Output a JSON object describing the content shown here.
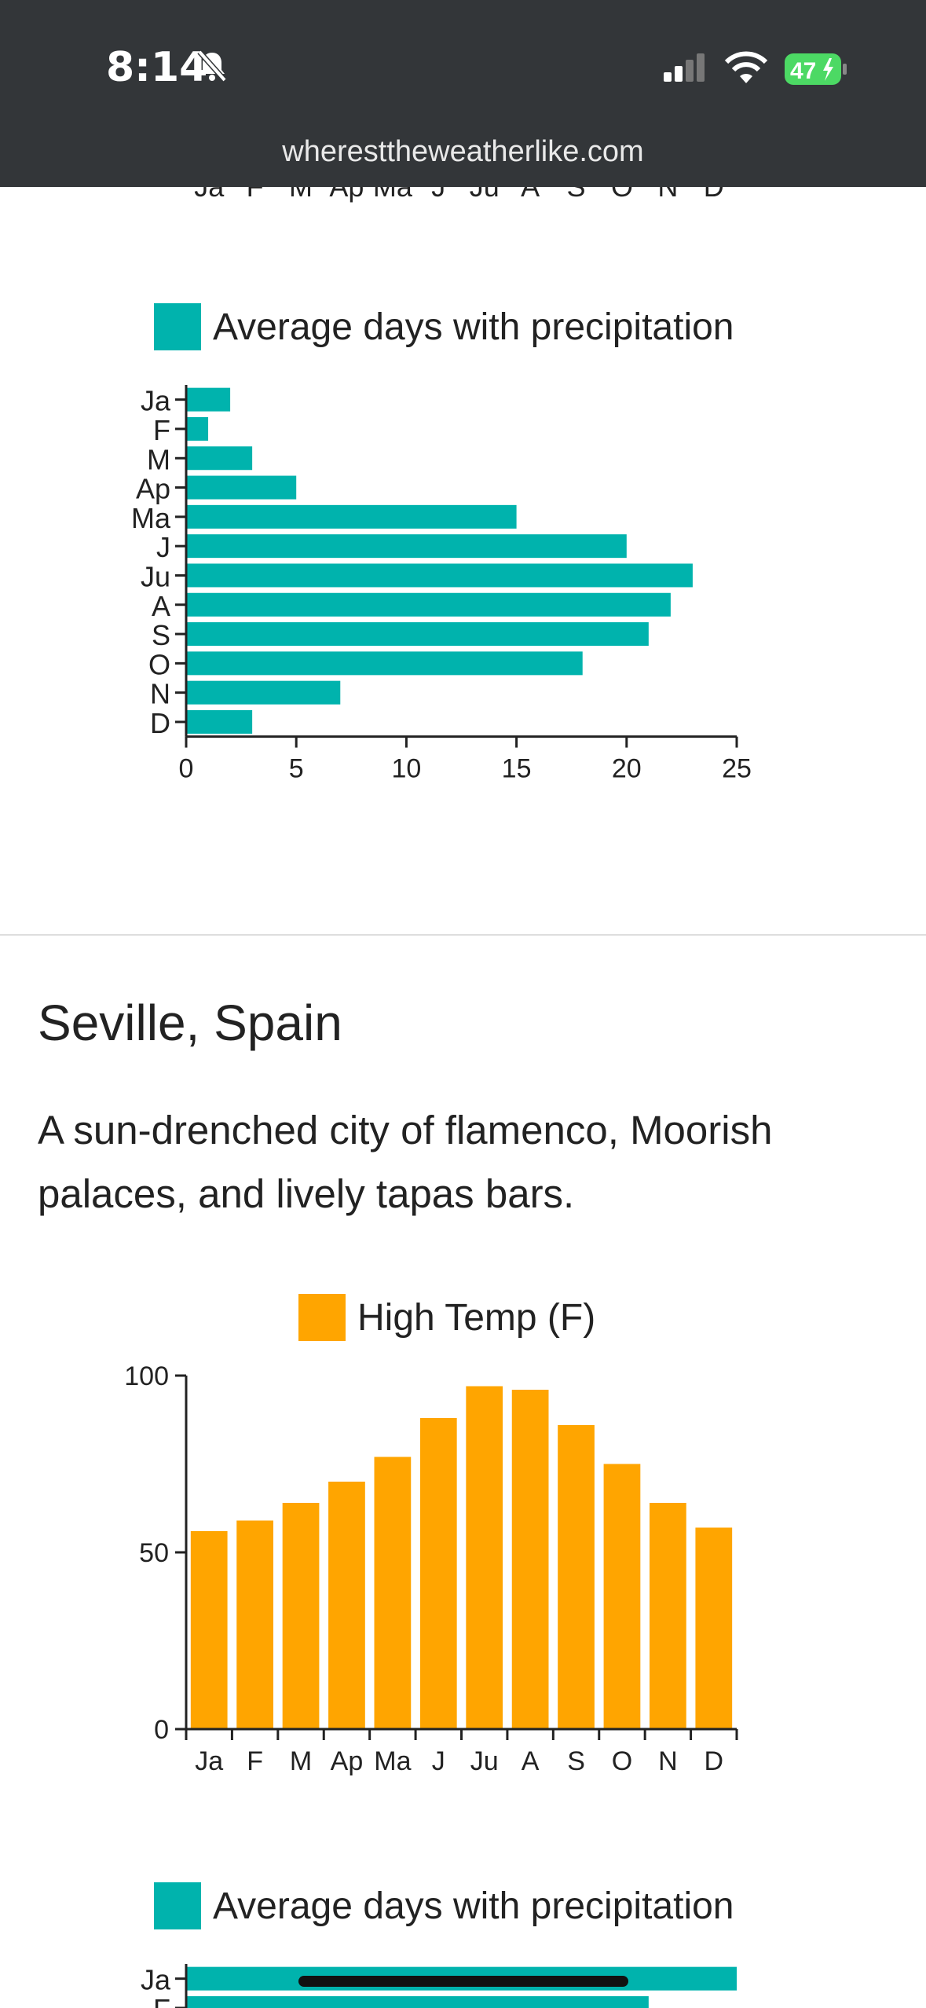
{
  "status_bar": {
    "time": "8:14",
    "battery_percent": "47",
    "icons": [
      "bell-muted-icon",
      "cellular-signal-icon",
      "wifi-icon",
      "battery-charging-icon"
    ]
  },
  "browser": {
    "url": "wheresttheweatherlike.com"
  },
  "top_chart_partial_labels": [
    "Ja",
    "F",
    "M",
    "Ap",
    "Ma",
    "J",
    "Ju",
    "A",
    "S",
    "O",
    "N",
    "D"
  ],
  "city": {
    "name": "Seville, Spain",
    "description": "A sun-drenched city of flamenco, Moorish palaces, and lively tapas bars."
  },
  "colors": {
    "precip": "#00b3ad",
    "temp": "#ffa500",
    "header": "#333639"
  },
  "chart_data": [
    {
      "type": "bar",
      "orientation": "horizontal",
      "legend": "Average days with precipitation",
      "categories": [
        "Ja",
        "F",
        "M",
        "Ap",
        "Ma",
        "J",
        "Ju",
        "A",
        "S",
        "O",
        "N",
        "D"
      ],
      "values": [
        2,
        1,
        3,
        5,
        15,
        20,
        23,
        22,
        21,
        18,
        7,
        3
      ],
      "xlim": [
        0,
        25
      ],
      "ticks": [
        "0",
        "5",
        "10",
        "15",
        "20",
        "25"
      ]
    },
    {
      "type": "bar",
      "orientation": "vertical",
      "legend": "High Temp (F)",
      "categories": [
        "Ja",
        "F",
        "M",
        "Ap",
        "Ma",
        "J",
        "Ju",
        "A",
        "S",
        "O",
        "N",
        "D"
      ],
      "values": [
        56,
        59,
        64,
        70,
        77,
        88,
        97,
        96,
        86,
        75,
        64,
        57
      ],
      "ylim": [
        0,
        100
      ],
      "ticks": [
        "0",
        "50",
        "100"
      ]
    },
    {
      "type": "bar",
      "orientation": "horizontal",
      "legend": "Average days with precipitation",
      "categories": [
        "Ja",
        "F"
      ],
      "values": [
        25,
        21
      ],
      "xlim": [
        0,
        25
      ]
    }
  ]
}
